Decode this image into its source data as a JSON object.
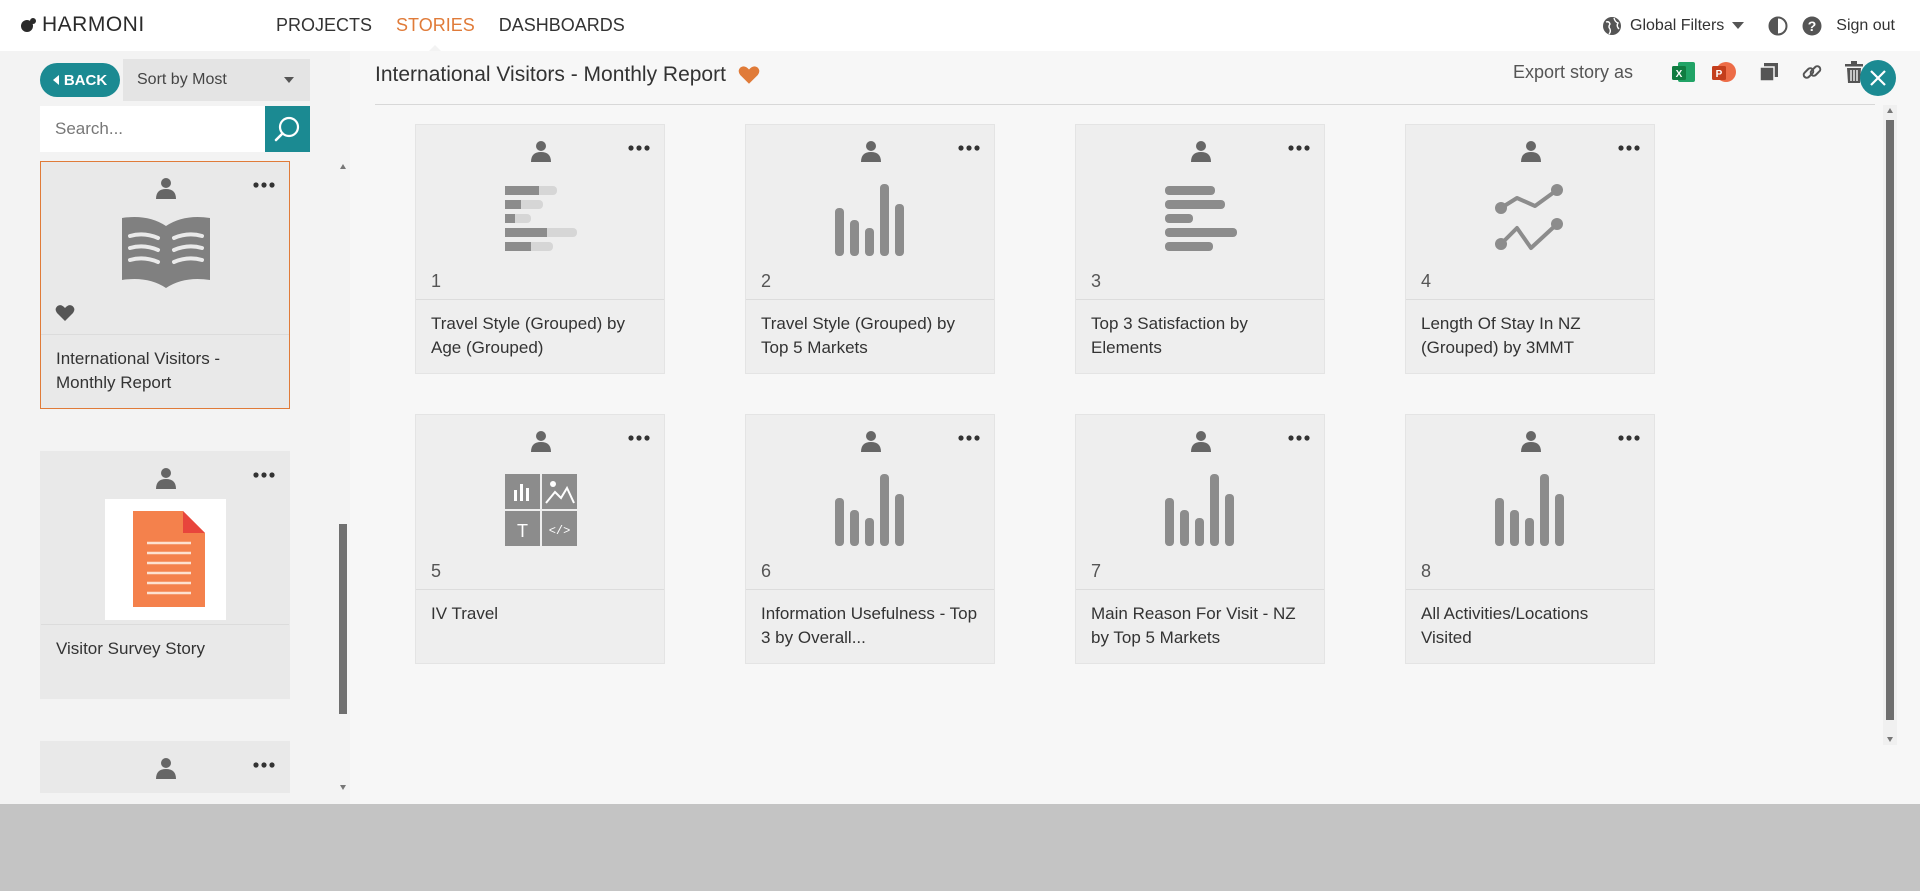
{
  "brand": {
    "name": "HARMONI"
  },
  "nav": {
    "items": [
      {
        "label": "PROJECTS",
        "active": false
      },
      {
        "label": "STORIES",
        "active": true
      },
      {
        "label": "DASHBOARDS",
        "active": false
      }
    ]
  },
  "topright": {
    "global_filters": "Global Filters",
    "sign_out": "Sign out"
  },
  "sidebar": {
    "back_label": "BACK",
    "sort_label": "Sort by Most",
    "search_placeholder": "Search...",
    "stories": [
      {
        "title": "International Visitors - Monthly Report",
        "selected": true,
        "favorite": true,
        "icon": "book-icon"
      },
      {
        "title": "Visitor Survey Story",
        "selected": false,
        "favorite": false,
        "icon": "document-icon"
      },
      {
        "title": "",
        "selected": false,
        "favorite": false,
        "icon": ""
      }
    ]
  },
  "story": {
    "title": "International Visitors - Monthly Report",
    "export_label": "Export story as",
    "cards": [
      {
        "number": "1",
        "title": "Travel Style (Grouped) by Age (Grouped)",
        "icon": "stacked-bar-icon"
      },
      {
        "number": "2",
        "title": "Travel Style (Grouped) by Top 5 Markets",
        "icon": "column-chart-icon"
      },
      {
        "number": "3",
        "title": "Top 3 Satisfaction by Elements",
        "icon": "bar-chart-icon"
      },
      {
        "number": "4",
        "title": "Length Of Stay In NZ (Grouped) by 3MMT",
        "icon": "line-chart-icon"
      },
      {
        "number": "5",
        "title": "IV Travel",
        "icon": "dashboard-tiles-icon"
      },
      {
        "number": "6",
        "title": "Information Usefulness - Top 3 by Overall...",
        "icon": "column-chart-icon"
      },
      {
        "number": "7",
        "title": "Main Reason For Visit - NZ by Top 5 Markets",
        "icon": "column-chart-icon"
      },
      {
        "number": "8",
        "title": "All Activities/Locations Visited",
        "icon": "column-chart-icon"
      }
    ]
  },
  "colors": {
    "accent": "#1b8a92",
    "active_nav": "#e07b39",
    "favorite": "#e07b39",
    "icon_gray": "#8c8c8c"
  }
}
